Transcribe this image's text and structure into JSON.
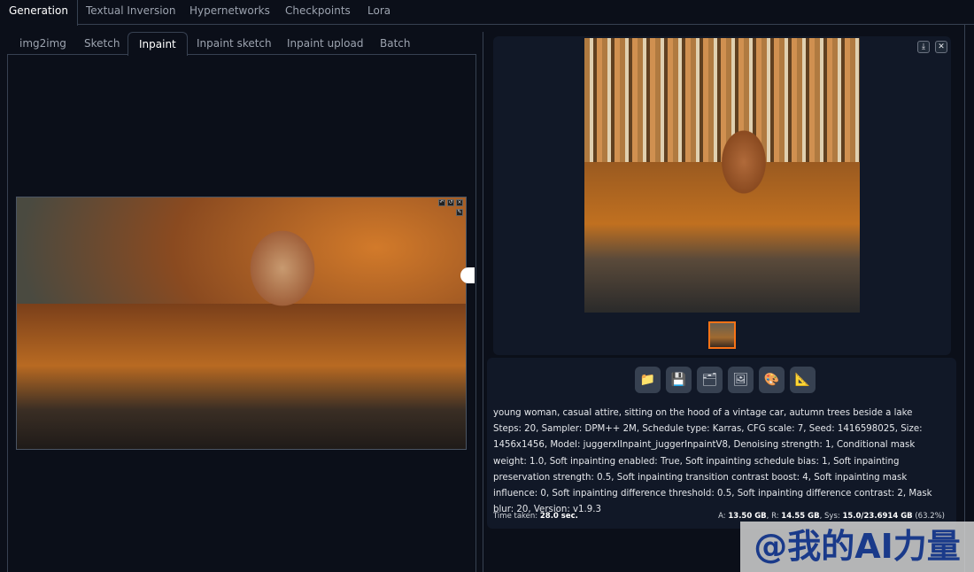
{
  "top_tabs": [
    "Generation",
    "Textual Inversion",
    "Hypernetworks",
    "Checkpoints",
    "Lora"
  ],
  "sub_tabs": [
    "img2img",
    "Sketch",
    "Inpaint",
    "Inpaint sketch",
    "Inpaint upload",
    "Batch"
  ],
  "canvas_icons": [
    "undo-icon",
    "reset-icon",
    "close-icon",
    "brush-icon"
  ],
  "gallery_buttons": {
    "download": "⤓",
    "close": "✕"
  },
  "tool_buttons": [
    {
      "name": "folder",
      "glyph": "📁"
    },
    {
      "name": "save",
      "glyph": "💾"
    },
    {
      "name": "zip",
      "glyph": "🗂"
    },
    {
      "name": "send-to-img2img",
      "glyph": "🖼"
    },
    {
      "name": "send-to-inpaint",
      "glyph": "🎨"
    },
    {
      "name": "send-to-extras",
      "glyph": "📐"
    }
  ],
  "info": {
    "prompt": "young woman, casual attire, sitting on the hood of a vintage car, autumn trees beside a lake",
    "params": "Steps: 20, Sampler: DPM++ 2M, Schedule type: Karras, CFG scale: 7, Seed: 1416598025, Size: 1456x1456, Model: juggerxlInpaint_juggerInpaintV8, Denoising strength: 1, Conditional mask weight: 1.0, Soft inpainting enabled: True, Soft inpainting schedule bias: 1, Soft inpainting preservation strength: 0.5, Soft inpainting transition contrast boost: 4, Soft inpainting mask influence: 0, Soft inpainting difference threshold: 0.5, Soft inpainting difference contrast: 2, Mask blur: 20, Version: v1.9.3",
    "time_label": "Time taken:",
    "time_value": "28.0 sec.",
    "mem_a_label": "A:",
    "mem_a": "13.50 GB",
    "mem_r_label": "R:",
    "mem_r": "14.55 GB",
    "mem_sys_label": "Sys:",
    "mem_sys": "15.0/23.6914 GB",
    "mem_pct": "(63.2%)"
  },
  "watermark": "@我的AI力量",
  "colors": {
    "accent": "#f97316",
    "background": "#0b0f19",
    "panel": "#111827"
  }
}
